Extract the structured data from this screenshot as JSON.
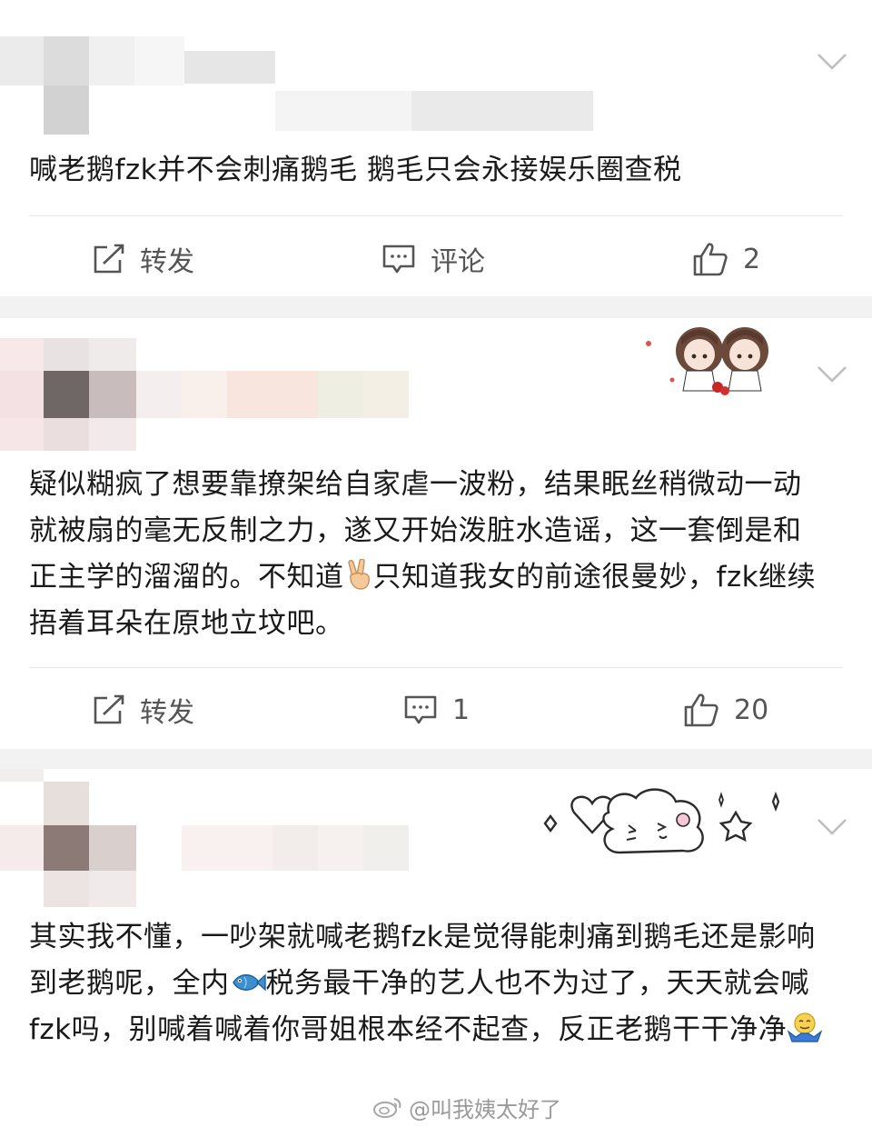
{
  "posts": [
    {
      "text": "喊老鹅fzk并不会刺痛鹅毛 鹅毛只会永接娱乐圈查税",
      "actions": {
        "repost": "转发",
        "comment": "评论",
        "likes": "2"
      }
    },
    {
      "text_parts": [
        "疑似糊疯了想要靠撩架给自家虐一波粉，结果眠丝稍微动一动就被扇的毫无反制之力，遂又开始泼脏水造谣，这一套倒是和正主学的溜溜的。不知道",
        "只知道我女的前途很曼妙，fzk继续捂着耳朵在原地立坟吧。"
      ],
      "emoji": "victory-hand",
      "actions": {
        "repost": "转发",
        "comment": "1",
        "likes": "20"
      }
    },
    {
      "text_parts": [
        "其实我不懂，一吵架就喊老鹅fzk是觉得能刺痛到鹅毛还是影响到老鹅呢，全内",
        "税务最干净的艺人也不为过了，天天就会喊fzk吗，别喊着喊着你哥姐根本经不起查，反正老鹅干干净净"
      ],
      "emojis": [
        "fish",
        "shrug-face"
      ]
    }
  ],
  "watermark": "@叫我姨太好了",
  "colors": {
    "background": "#f2f2f2",
    "card": "#ffffff",
    "text": "#1a1a1a",
    "icon": "#555555"
  }
}
